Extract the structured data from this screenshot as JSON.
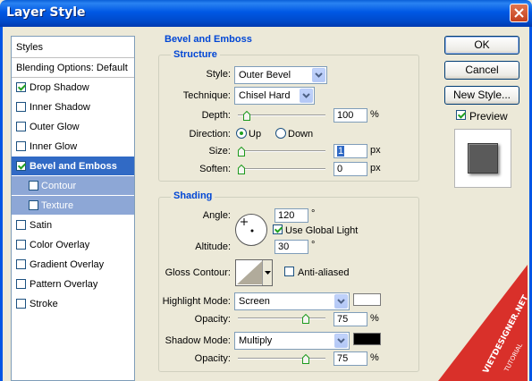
{
  "window": {
    "title": "Layer Style"
  },
  "styles_list": {
    "header": "Styles",
    "blending_options": "Blending Options: Default",
    "items": [
      {
        "label": "Drop Shadow",
        "checked": true
      },
      {
        "label": "Inner Shadow",
        "checked": false
      },
      {
        "label": "Outer Glow",
        "checked": false
      },
      {
        "label": "Inner Glow",
        "checked": false
      },
      {
        "label": "Bevel and Emboss",
        "checked": true,
        "selected": true
      },
      {
        "label": "Contour",
        "checked": false,
        "sub": true
      },
      {
        "label": "Texture",
        "checked": false,
        "sub": true
      },
      {
        "label": "Satin",
        "checked": false
      },
      {
        "label": "Color Overlay",
        "checked": false
      },
      {
        "label": "Gradient Overlay",
        "checked": false
      },
      {
        "label": "Pattern Overlay",
        "checked": false
      },
      {
        "label": "Stroke",
        "checked": false
      }
    ]
  },
  "bevel": {
    "title": "Bevel and Emboss",
    "structure": {
      "title": "Structure",
      "style_label": "Style:",
      "style_value": "Outer Bevel",
      "technique_label": "Technique:",
      "technique_value": "Chisel Hard",
      "depth_label": "Depth:",
      "depth_value": "100",
      "depth_unit": "%",
      "direction_label": "Direction:",
      "up_label": "Up",
      "down_label": "Down",
      "direction": "Up",
      "size_label": "Size:",
      "size_value": "1",
      "size_unit": "px",
      "soften_label": "Soften:",
      "soften_value": "0",
      "soften_unit": "px"
    },
    "shading": {
      "title": "Shading",
      "angle_label": "Angle:",
      "angle_value": "120",
      "angle_unit": "°",
      "global_light_label": "Use Global Light",
      "global_light": true,
      "altitude_label": "Altitude:",
      "altitude_value": "30",
      "altitude_unit": "°",
      "gloss_label": "Gloss Contour:",
      "anti_aliased_label": "Anti-aliased",
      "anti_aliased": false,
      "highlight_mode_label": "Highlight Mode:",
      "highlight_mode": "Screen",
      "highlight_color": "#ffffff",
      "highlight_opacity_label": "Opacity:",
      "highlight_opacity": "75",
      "highlight_opacity_unit": "%",
      "shadow_mode_label": "Shadow Mode:",
      "shadow_mode": "Multiply",
      "shadow_color": "#000000",
      "shadow_opacity_label": "Opacity:",
      "shadow_opacity": "75",
      "shadow_opacity_unit": "%"
    }
  },
  "buttons": {
    "ok": "OK",
    "cancel": "Cancel",
    "new_style": "New Style...",
    "preview_label": "Preview",
    "preview": true
  },
  "watermark": {
    "line1": "VIETDESIGNER.NET",
    "line2": "TUTORIAL"
  },
  "colors": {
    "titlebar": "#0058e4",
    "selection": "#316ac5",
    "section_title": "#0046d5"
  }
}
